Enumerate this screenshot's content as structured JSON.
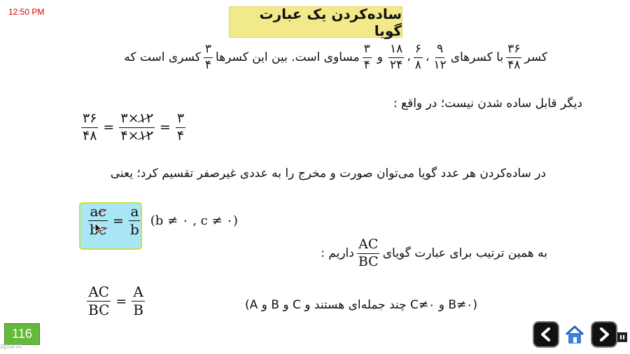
{
  "status": {
    "time": "12:50 PM"
  },
  "title": "ساده‌کردن یک عبارت گویا",
  "para1": {
    "t1": "کسر",
    "f1": {
      "num": "۳۶",
      "den": "۴۸"
    },
    "t2": "با کسرهای",
    "f2": {
      "num": "۹",
      "den": "۱۲"
    },
    "f3": {
      "num": "۶",
      "den": "۸"
    },
    "f4": {
      "num": "۱۸",
      "den": "۲۴"
    },
    "t3": "و",
    "f5": {
      "num": "۳",
      "den": "۴"
    },
    "t4": "مساوی است. بین این کسرها",
    "f6": {
      "num": "۳",
      "den": "۴"
    },
    "t5": "کسری است که",
    "sep": "،"
  },
  "para2": "دیگر قابل ساده شدن نیست؛ در واقع :",
  "eq1": {
    "lhs": {
      "num": "۳۶",
      "den": "۴۸"
    },
    "mid": {
      "num_a": "۳",
      "num_b": "۱۲",
      "den_a": "۴",
      "den_b": "۱۲",
      "times": "×"
    },
    "rhs": {
      "num": "۳",
      "den": "۴"
    },
    "eq": "="
  },
  "para3": "در ساده‌کردن هر عدد گویا می‌توان صورت و مخرج را به عددی غیرصفر تقسیم کرد؛ یعنی",
  "rule": {
    "lhs_num_a": "a",
    "lhs_num_c": "c",
    "lhs_den_b": "b",
    "lhs_den_c": "c",
    "rhs_num": "a",
    "rhs_den": "b",
    "eq": "=",
    "cond": "(b ≠ ۰ , c ≠ ۰)"
  },
  "para4": {
    "before": "به همین ترتیب برای عبارت گویای",
    "frac": {
      "num": "AC",
      "den": "BC"
    },
    "after": "داریم :"
  },
  "eq2": {
    "lhs": {
      "num": "AC",
      "den": "BC"
    },
    "rhs": {
      "num": "A",
      "den": "B"
    },
    "eq": "="
  },
  "note": "(A و B و C چند جمله‌ای هستند و C≠۰ و B≠۰)",
  "footer": {
    "page": "116",
    "watermark": "aparat"
  },
  "nav": {
    "prev": "arrow-left-icon",
    "home": "home-icon",
    "next": "arrow-right-icon",
    "pause": "pause-icon"
  }
}
